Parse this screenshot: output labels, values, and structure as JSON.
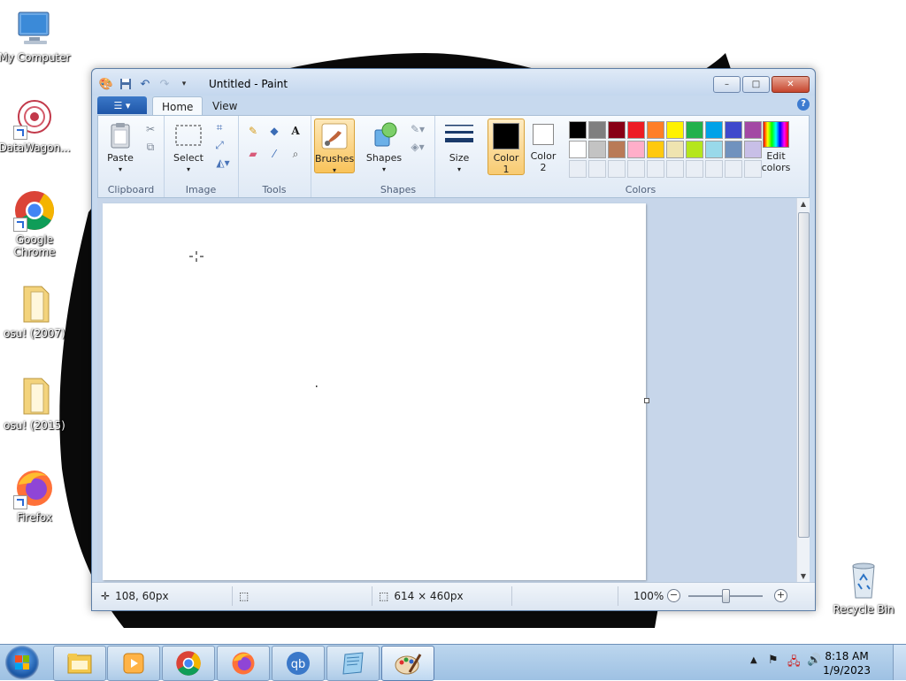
{
  "desktop": {
    "icons": [
      {
        "label": "My Computer"
      },
      {
        "label": "DataWagon..."
      },
      {
        "label": "Google Chrome"
      },
      {
        "label": "osu! (2007)"
      },
      {
        "label": "osu! (2015)"
      },
      {
        "label": "Firefox"
      },
      {
        "label": "Recycle Bin"
      }
    ]
  },
  "window": {
    "title": "Untitled - Paint",
    "controls": {
      "minimize": "–",
      "maximize": "□",
      "close": "✕"
    }
  },
  "ribbon": {
    "file_tab": "☰ ▾",
    "tabs": [
      {
        "label": "Home"
      },
      {
        "label": "View"
      }
    ],
    "help": "?",
    "groups": {
      "clipboard": {
        "label": "Clipboard",
        "paste": "Paste"
      },
      "image": {
        "label": "Image",
        "select": "Select"
      },
      "tools": {
        "label": "Tools"
      },
      "brushes": {
        "label": "Brushes"
      },
      "shapes": {
        "label": "Shapes",
        "shapes_btn": "Shapes"
      },
      "size": {
        "label": "Size"
      },
      "colors": {
        "label": "Colors",
        "color1": "Color\n1",
        "color1_l1": "Color",
        "color1_l2": "1",
        "color2_l1": "Color",
        "color2_l2": "2",
        "edit_l1": "Edit",
        "edit_l2": "colors",
        "color1_value": "#000000",
        "color2_value": "#ffffff",
        "palette_row1": [
          "#000000",
          "#7f7f7f",
          "#880015",
          "#ed1c24",
          "#ff7f27",
          "#fff200",
          "#22b14c",
          "#00a2e8",
          "#3f48cc",
          "#a349a4"
        ],
        "palette_row2": [
          "#ffffff",
          "#c3c3c3",
          "#b97a57",
          "#ffaec9",
          "#ffc90e",
          "#efe4b0",
          "#b5e61d",
          "#99d9ea",
          "#7092be",
          "#c8bfe7"
        ]
      }
    }
  },
  "status": {
    "cursor_pos": "108, 60px",
    "selection": "",
    "image_size": "614 × 460px",
    "zoom": "100%",
    "zoom_level": 0.5
  },
  "taskbar": {
    "clock_time": "8:18 AM",
    "clock_date": "1/9/2023"
  }
}
